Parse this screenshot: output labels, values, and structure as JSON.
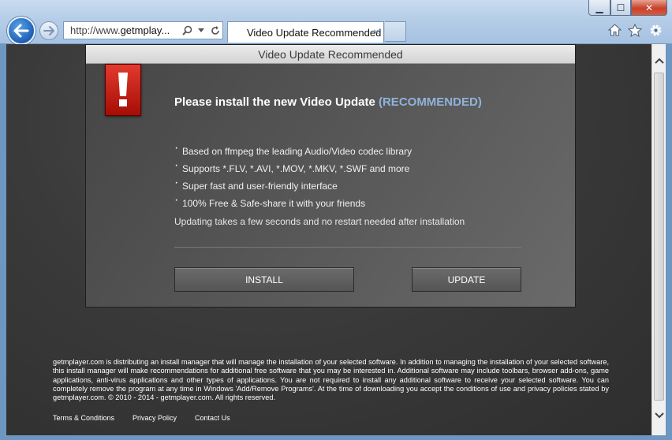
{
  "browser": {
    "window_controls": {
      "minimize": "▁",
      "maximize": "☐",
      "close": "✕"
    },
    "address": {
      "url_prefix": "http://www.",
      "url_host": "getmplay..."
    },
    "tab": {
      "title": "Video Update Recommended",
      "close": "×"
    },
    "icons": [
      "back-arrow-icon",
      "forward-arrow-icon",
      "search-icon",
      "dropdown-icon",
      "refresh-icon",
      "home-icon",
      "favorites-star-icon",
      "gear-icon"
    ],
    "accent_color": "#1e5fb5"
  },
  "dialog": {
    "title": "Video Update Recommended",
    "headline": "Please install the new Video Update",
    "headline_highlight": "(RECOMMENDED)",
    "features": [
      "Based on ffmpeg the leading Audio/Video codec library",
      "Supports *.FLV, *.AVI, *.MOV, *.MKV, *.SWF and more",
      "Super fast and user-friendly interface",
      "100% Free & Safe-share it with your friends"
    ],
    "note": "Updating takes a few seconds and no restart needed after installation",
    "install_label": "INSTALL",
    "update_label": "UPDATE",
    "warning_color": "#d2261b"
  },
  "footer": {
    "disclaimer": "getmplayer.com is distributing an install manager that will manage the installation of your selected software. In addition to managing the installation of your selected software, this install manager will make recommendations for additional free software that you may be interested in. Additional software may include toolbars, browser add-ons, game applications, anti-virus applications and other types of applications. You are not required to install any additional software to receive your selected software. You can completely remove the program at any time in Windows 'Add/Remove Programs'. At the time of downloading you accept the conditions of use and privacy policies stated by getmplayer.com. © 2010 - 2014 - getmplayer.com. All rights reserved.",
    "links": [
      "Terms & Conditions",
      "Privacy Policy",
      "Contact Us"
    ]
  }
}
